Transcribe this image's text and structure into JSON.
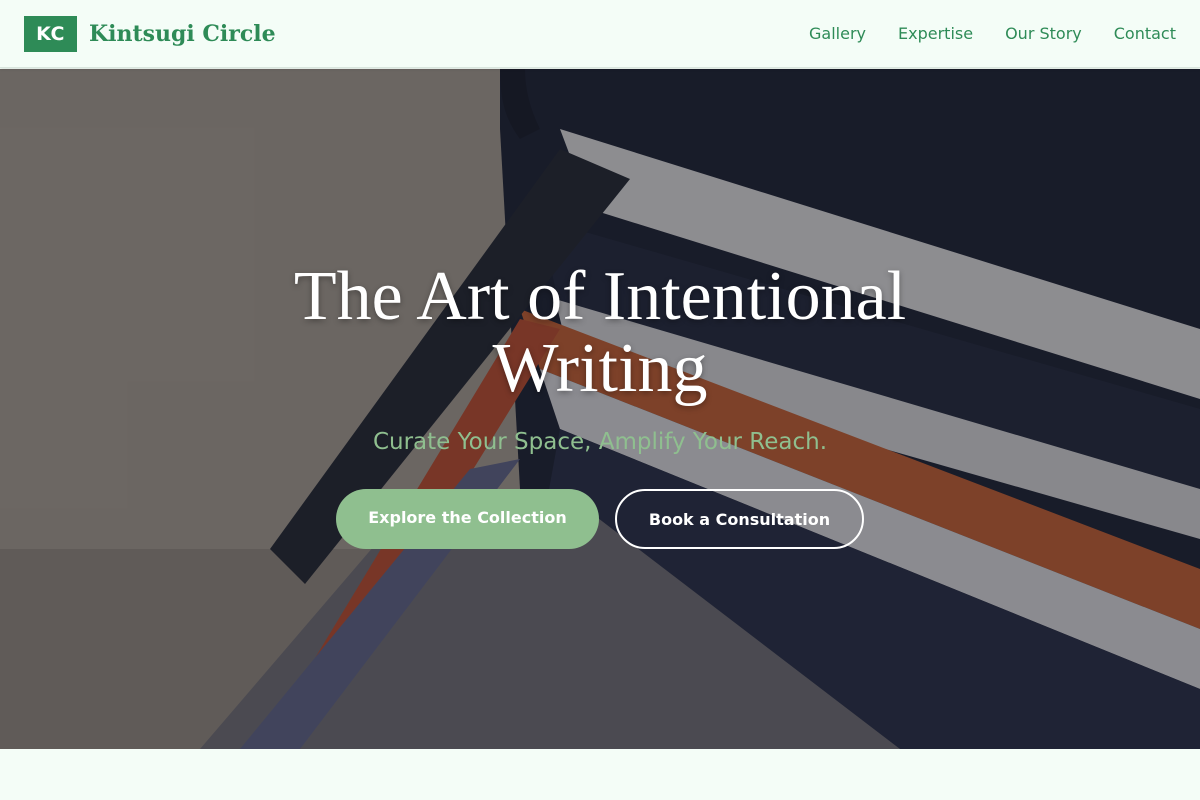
{
  "brand": {
    "logo_text": "KC",
    "name": "Kintsugi Circle"
  },
  "nav": {
    "items": [
      {
        "label": "Gallery"
      },
      {
        "label": "Expertise"
      },
      {
        "label": "Our Story"
      },
      {
        "label": "Contact"
      }
    ]
  },
  "hero": {
    "title": "The Art of Intentional Writing",
    "subtitle": "Curate Your Space, Amplify Your Reach.",
    "primary_cta": "Explore the Collection",
    "secondary_cta": "Book a Consultation",
    "background_image": "stacked-notebooks-with-ribbon-bookmarks"
  },
  "colors": {
    "brand_green": "#2e8b57",
    "sage": "#8fbf8f",
    "page_bg": "#f4fdf7"
  }
}
